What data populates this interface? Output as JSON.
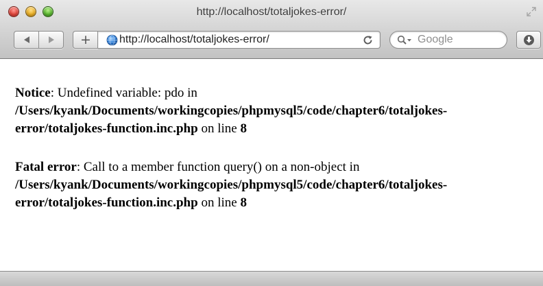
{
  "window": {
    "title": "http://localhost/totaljokes-error/"
  },
  "toolbar": {
    "back_icon": "back-arrow-icon",
    "forward_icon": "forward-arrow-icon",
    "add_label": "+",
    "address": {
      "value": "http://localhost/totaljokes-error/",
      "icon": "globe-icon",
      "reload_icon": "reload-icon"
    },
    "search": {
      "placeholder": "Google",
      "icon": "search-icon"
    },
    "download_icon": "download-icon"
  },
  "content": {
    "notice": {
      "label": "Notice",
      "message": ": Undefined variable: pdo in",
      "path_line1": "/Users/kyank/Documents/workingcopies/phpmysql5/code/chapter6/totaljokes-",
      "path_line2": "error/totaljokes-function.inc.php",
      "on_line": " on line ",
      "line_number": "8"
    },
    "fatal": {
      "label": "Fatal error",
      "message": ": Call to a member function query() on a non-object in",
      "path_line1": "/Users/kyank/Documents/workingcopies/phpmysql5/code/chapter6/totaljokes-",
      "path_line2": "error/totaljokes-function.inc.php",
      "on_line": " on line ",
      "line_number": "8"
    }
  },
  "colors": {
    "close": "#e0443a",
    "minimize": "#e9ad22",
    "zoom": "#57b52d",
    "globe": "#2f7fd8"
  }
}
